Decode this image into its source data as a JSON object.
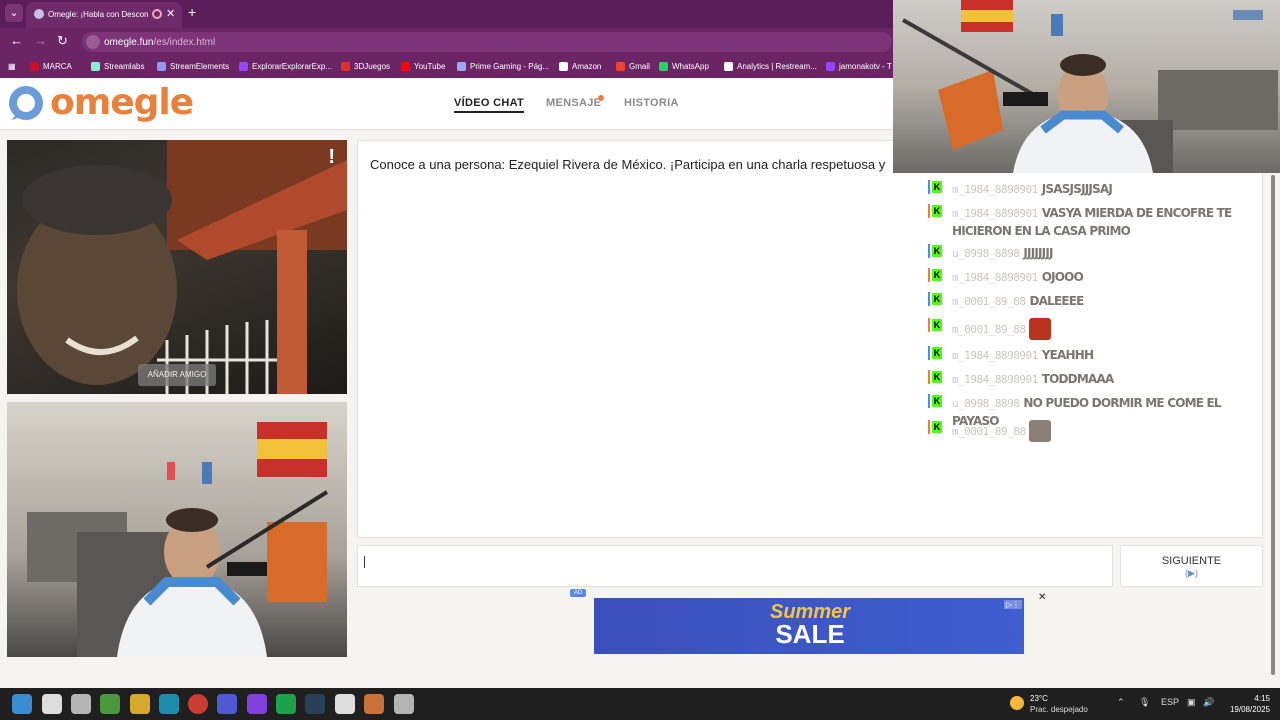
{
  "browser": {
    "tab_title": "Omegle: ¡Habla con Descon",
    "url_host": "omegle.fun",
    "url_path": "/es/index.html",
    "bookmarks": [
      {
        "label": "MARCA",
        "color": "#c8102e"
      },
      {
        "label": "Streamlabs",
        "color": "#80f5d2"
      },
      {
        "label": "StreamElements",
        "color": "#8e9cf7"
      },
      {
        "label": "ExplorarExplorarExp...",
        "color": "#9146ff"
      },
      {
        "label": "3DJuegos",
        "color": "#e22e2e"
      },
      {
        "label": "YouTube",
        "color": "#ff0000"
      },
      {
        "label": "Prime Gaming - Pág...",
        "color": "#9fa8ff"
      },
      {
        "label": "Amazon",
        "color": "#ffffff"
      },
      {
        "label": "Gmail",
        "color": "#ea4335"
      },
      {
        "label": "WhatsApp",
        "color": "#25d366"
      },
      {
        "label": "Analytics | Restream...",
        "color": "#ffffff"
      },
      {
        "label": "jamonakotv - T",
        "color": "#9146ff"
      }
    ]
  },
  "omegle": {
    "logo": "omegle",
    "nav": {
      "video_chat": "VÍDEO CHAT",
      "message": "MENSAJE",
      "history": "HISTORIA"
    },
    "add_friend": "AÑADIR AMIGO",
    "report_mark": "!",
    "intro": "Conoce a una persona: Ezequiel Rivera de México. ¡Participa en una charla respetuosa y",
    "next_button": "SIGUIENTE",
    "next_sub": "(▶)",
    "ad_tag": "AD",
    "ad_line1": "Summer",
    "ad_line2": "SALE",
    "ad_close": "✕",
    "accent_color": "#e8813c"
  },
  "stream_chat": [
    {
      "user": "m_1984_8898901",
      "text": "JSASJSJJJSAJ",
      "bar": "#4a90e2"
    },
    {
      "user": "m_1984_8898901",
      "text": "VASYA MIERDA DE ENCOFRE TE HICIERON EN LA CASA PRIMO",
      "bar": "#e8813c"
    },
    {
      "user": "u_8998_8898",
      "text": "JJJJJJJJ",
      "bar": "#4a90e2"
    },
    {
      "user": "m_1984_8898901",
      "text": "OJOOO",
      "bar": "#e8813c"
    },
    {
      "user": "m_0001_89_88",
      "text": "DALEEEE",
      "bar": "#4a90e2"
    },
    {
      "user": "m_0001_89_88",
      "text": "",
      "bar": "#e8813c",
      "emote": "#b8321e"
    },
    {
      "user": "m_1984_8898901",
      "text": "YEAHHH",
      "bar": "#4a90e2"
    },
    {
      "user": "m_1984_8898901",
      "text": "TODDMAAA",
      "bar": "#e8813c"
    },
    {
      "user": "u_8998_8898",
      "text": "NO PUEDO DORMIR ME COME EL PAYASO",
      "bar": "#4a90e2"
    },
    {
      "user": "m_0001_89_88",
      "text": "",
      "bar": "#e8813c",
      "emote": "#8a8076"
    }
  ],
  "taskbar": {
    "weather_temp": "23°C",
    "weather_cond": "Prac. despejado",
    "lang": "ESP",
    "time": "4:15",
    "date": "19/08/2025"
  }
}
